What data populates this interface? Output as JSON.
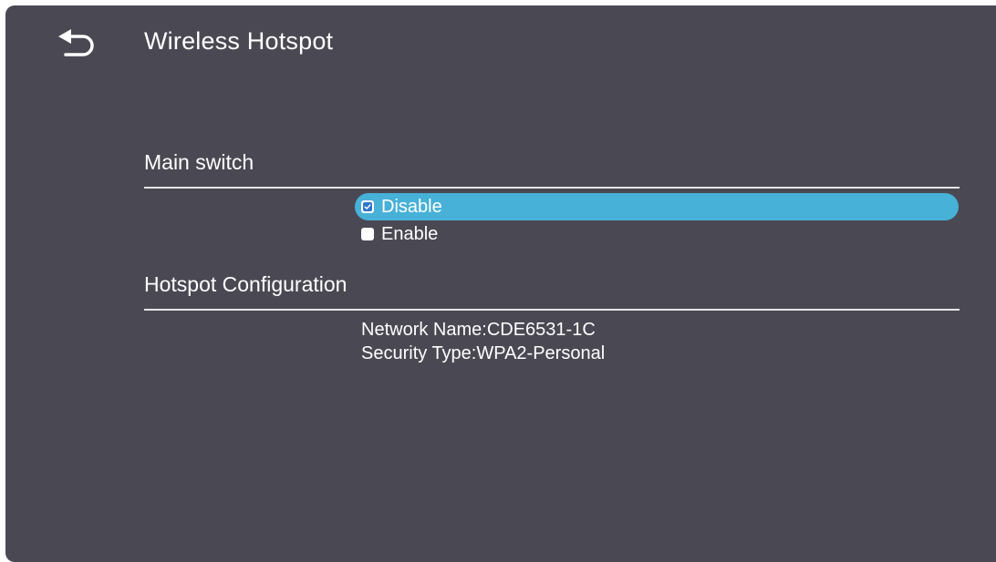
{
  "header": {
    "title": "Wireless Hotspot",
    "back_icon": "back-arrow-icon"
  },
  "main_switch": {
    "label": "Main switch",
    "options": [
      {
        "label": "Disable",
        "checked": true,
        "selected": true
      },
      {
        "label": "Enable",
        "checked": false,
        "selected": false
      }
    ]
  },
  "hotspot_config": {
    "label": "Hotspot Configuration",
    "network_name": "Network Name:CDE6531-1C",
    "security_type": "Security Type:WPA2-Personal"
  },
  "colors": {
    "background": "#4a4953",
    "highlight": "#47b1d8",
    "text": "#ffffff",
    "check_accent": "#2f76c9"
  }
}
